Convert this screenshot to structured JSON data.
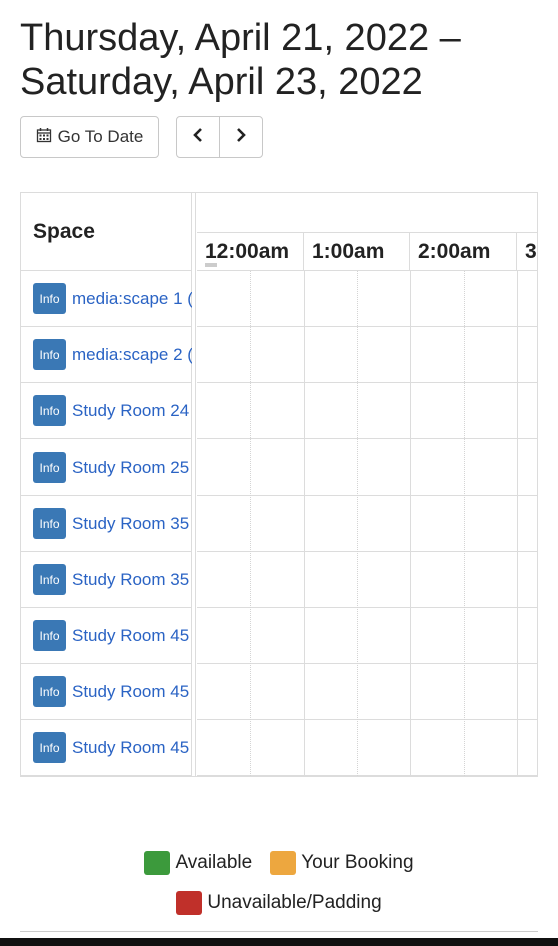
{
  "page_title": "Thursday, April 21, 2022 – Saturday, April 23, 2022",
  "toolbar": {
    "go_to_date_label": "Go To Date",
    "prev_icon": "chevron-left-icon",
    "next_icon": "chevron-right-icon",
    "calendar_icon": "calendar-icon"
  },
  "grid": {
    "space_header": "Space",
    "time_headers": [
      "12:00am",
      "1:00am",
      "2:00am",
      "3"
    ],
    "info_label": "Info",
    "rooms": [
      "media:scape 1 (",
      "media:scape 2 (",
      "Study Room 24",
      "Study Room 25",
      "Study Room 35",
      "Study Room 35",
      "Study Room 45",
      "Study Room 45",
      "Study Room 45"
    ]
  },
  "legend": {
    "available": "Available",
    "your_booking": "Your Booking",
    "unavailable": "Unavailable/Padding",
    "colors": {
      "available": "#3c9a3c",
      "your_booking": "#eda73f",
      "unavailable": "#c0302a"
    }
  }
}
